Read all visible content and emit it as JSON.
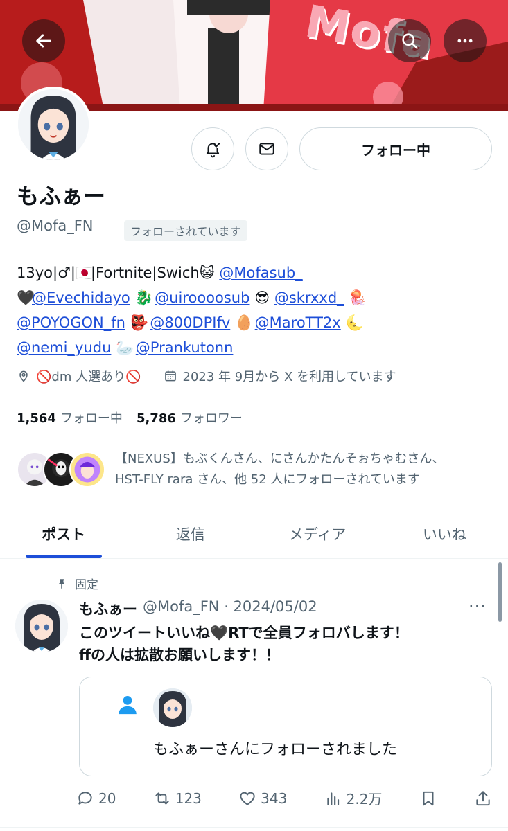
{
  "profile": {
    "display_name": "もふぁー",
    "handle": "@Mofa_FN",
    "follows_you": "フォローされています",
    "follow_button": "フォロー中",
    "banner_text": "Mofa"
  },
  "bio": {
    "line1_text": "13yo|♂|",
    "line1_flag": "🇯🇵",
    "line1_rest": "|Fortnite|Swich",
    "line1_emoji": "😺",
    "mentions": [
      "@Mofasub_",
      "@Evechidayo",
      "@uiroooosub",
      "@skrxxd_",
      "@POYOGON_fn",
      "@800DPIfv",
      "@MaroTT2x",
      "@nemi_yudu",
      "@Prankutonn"
    ],
    "emojis": [
      "🖤",
      "🐉",
      "😎",
      "🪼",
      "👺",
      "🥚",
      "🌜",
      "🦢"
    ]
  },
  "meta": {
    "location": "🚫dm 人選あり🚫",
    "joined": "2023 年 9月から X を利用しています"
  },
  "counts": {
    "following_num": "1,564",
    "following_label": "フォロー中",
    "followers_num": "5,786",
    "followers_label": "フォロワー"
  },
  "known_followers": {
    "line1": "【NEXUS】もぶくんさん、にさんかたんそぉちゃむさん、",
    "line2": "HST-FLY rara さん、他 52 人にフォローされています"
  },
  "tabs": [
    {
      "label": "ポスト",
      "active": true
    },
    {
      "label": "返信",
      "active": false
    },
    {
      "label": "メディア",
      "active": false
    },
    {
      "label": "いいね",
      "active": false
    }
  ],
  "tweet": {
    "pinned_label": "固定",
    "name": "もふぁー",
    "handle_date": "@Mofa_FN · 2024/05/02",
    "more": "···",
    "body_line1": "このツイートいいね🖤RTで全員フォロバします！",
    "body_line2": "ffの人は拡散お願いします！！",
    "card_text": "もふぁーさんにフォローされました",
    "stats": {
      "replies": "20",
      "reposts": "123",
      "likes": "343",
      "views": "2.2万"
    }
  },
  "colors": {
    "accent": "#1d4ed8",
    "muted": "#536471",
    "border": "#cfd9de"
  }
}
